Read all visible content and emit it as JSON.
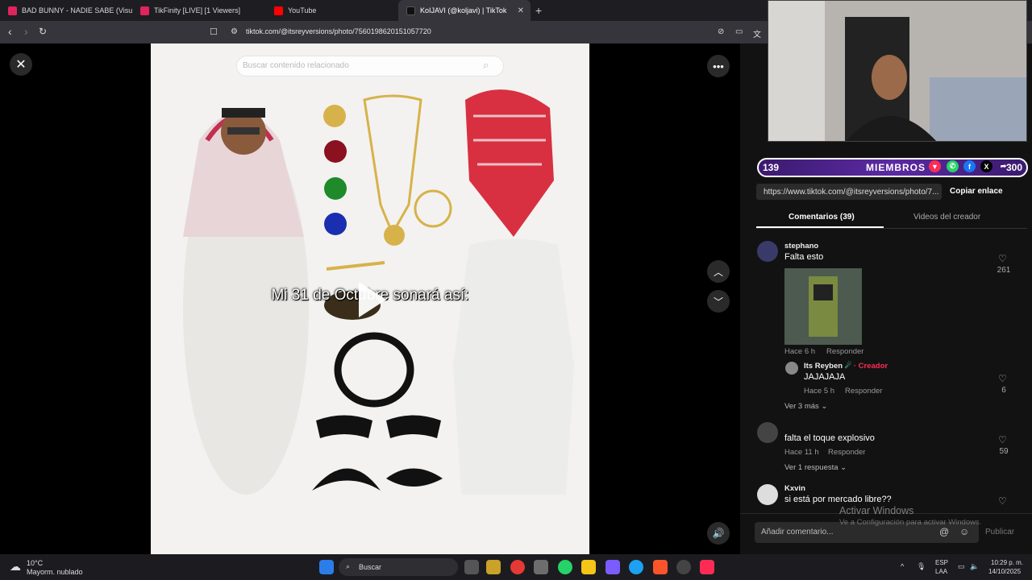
{
  "browser": {
    "tabs": [
      {
        "title": "BAD BUNNY - NADIE SABE (Visualize",
        "color": "#e0245e",
        "active": false
      },
      {
        "title": "TikFinity [LIVE] [1 Viewers]",
        "color": "#e0245e",
        "active": false
      },
      {
        "title": "YouTube",
        "color": "#ff0000",
        "active": false
      },
      {
        "title": "KoIJAVI (@koljavi) | TikTok",
        "color": "#111111",
        "active": true
      }
    ],
    "url": "tiktok.com/@itsreyversions/photo/7560198620151057720"
  },
  "video": {
    "search_placeholder": "Buscar contenido relacionado",
    "caption": "Mi 31 de Octubre sonará así:"
  },
  "overlay": {
    "left_count": "139",
    "members_label": "MIEMBROS",
    "right_count": "300"
  },
  "share": {
    "link": "https://www.tiktok.com/@itsreyversions/photo/7...",
    "copy_label": "Copiar enlace"
  },
  "tabs": {
    "comments": "Comentarios (39)",
    "creator_videos": "Videos del creador"
  },
  "comments": [
    {
      "user": "stephano",
      "text": "Falta esto",
      "time": "Hace 6 h",
      "reply": "Responder",
      "likes": "261"
    },
    {
      "user": "Its Reyben",
      "badge": "· Creador",
      "text": "JAJAJAJA",
      "time": "Hace 5 h",
      "reply": "Responder",
      "likes": "6"
    },
    {
      "more": "Ver 3 más"
    },
    {
      "user": "",
      "text": "falta el toque explosivo",
      "time": "Hace 11 h",
      "reply": "Responder",
      "likes": "59"
    },
    {
      "more": "Ver 1 respuesta"
    },
    {
      "user": "Kxvin",
      "text": "si está por mercado libre??",
      "likes": ""
    }
  ],
  "watermark": {
    "line1": "Activar Windows",
    "line2": "Ve a Configuración para activar Windows."
  },
  "composer": {
    "placeholder": "Añadir comentario...",
    "publish": "Publicar"
  },
  "taskbar": {
    "weather_temp": "10°C",
    "weather_desc": "Mayorm. nublado",
    "search": "Buscar",
    "lang1": "ESP",
    "lang2": "LAA",
    "time": "10:29 p. m.",
    "date": "14/10/2025"
  }
}
